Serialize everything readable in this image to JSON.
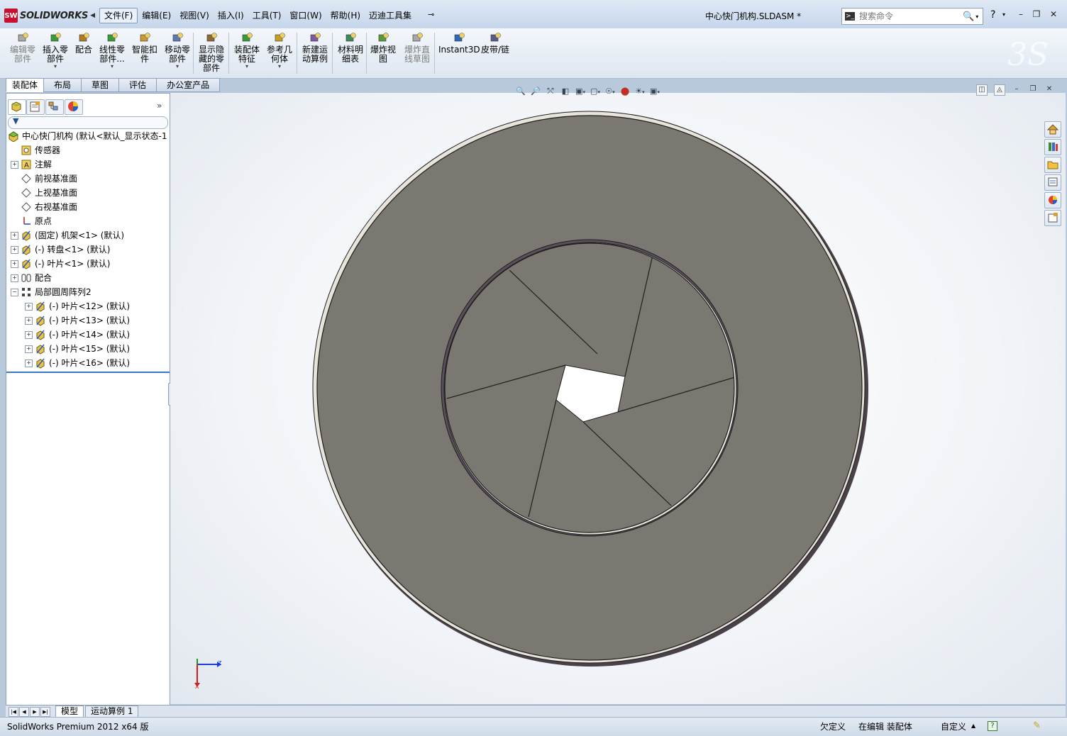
{
  "window": {
    "app_name": "SOLIDWORKS",
    "document_title": "中心快门机构.SLDASM *",
    "search_placeholder": "搜索命令",
    "help_label": "?"
  },
  "menu": [
    "文件(F)",
    "编辑(E)",
    "视图(V)",
    "插入(I)",
    "工具(T)",
    "窗口(W)",
    "帮助(H)",
    "迈迪工具集"
  ],
  "ribbon": {
    "buttons": [
      {
        "id": "edit-component",
        "label": "编辑零\n部件",
        "disabled": true,
        "icon": "edit-component-icon"
      },
      {
        "id": "insert-component",
        "label": "插入零\n部件",
        "dropdown": true,
        "icon": "insert-component-icon"
      },
      {
        "id": "mate",
        "label": "配合",
        "icon": "mate-icon"
      },
      {
        "id": "linear-pattern",
        "label": "线性零\n部件...",
        "dropdown": true,
        "icon": "linear-pattern-icon"
      },
      {
        "id": "smart-fastener",
        "label": "智能扣\n件",
        "icon": "smart-fastener-icon"
      },
      {
        "id": "move-component",
        "label": "移动零\n部件",
        "dropdown": true,
        "icon": "move-component-icon"
      },
      {
        "id": "show-hidden",
        "label": "显示隐\n藏的零\n部件",
        "icon": "show-hidden-icon"
      },
      {
        "id": "assembly-features",
        "label": "装配体\n特征",
        "dropdown": true,
        "icon": "assembly-features-icon"
      },
      {
        "id": "reference-geometry",
        "label": "参考几\n何体",
        "dropdown": true,
        "icon": "reference-geometry-icon"
      },
      {
        "id": "new-motion-study",
        "label": "新建运\n动算例",
        "icon": "motion-study-icon"
      },
      {
        "id": "bom",
        "label": "材料明\n细表",
        "icon": "bom-icon"
      },
      {
        "id": "exploded-view",
        "label": "爆炸视\n图",
        "icon": "exploded-view-icon"
      },
      {
        "id": "explode-line",
        "label": "爆炸直\n线草图",
        "disabled": true,
        "icon": "explode-line-icon"
      },
      {
        "id": "instant3d",
        "label": "Instant3D",
        "icon": "instant3d-icon"
      },
      {
        "id": "belt-chain",
        "label": "皮带/链",
        "icon": "belt-chain-icon"
      }
    ]
  },
  "cm_tabs": [
    "装配体",
    "布局",
    "草图",
    "评估",
    "办公室产品"
  ],
  "tree": {
    "root": "中心快门机构  (默认<默认_显示状态-1",
    "items": [
      {
        "label": "传感器",
        "indent": 1,
        "expand": false,
        "icon": "sensor-icon"
      },
      {
        "label": "注解",
        "indent": 1,
        "expand": true,
        "icon": "annotation-icon"
      },
      {
        "label": "前视基准面",
        "indent": 1,
        "expand": false,
        "icon": "plane-icon"
      },
      {
        "label": "上视基准面",
        "indent": 1,
        "expand": false,
        "icon": "plane-icon"
      },
      {
        "label": "右视基准面",
        "indent": 1,
        "expand": false,
        "icon": "plane-icon"
      },
      {
        "label": "原点",
        "indent": 1,
        "expand": false,
        "icon": "origin-icon"
      },
      {
        "label": "(固定) 机架<1> (默认)",
        "indent": 1,
        "expand": true,
        "icon": "part-icon"
      },
      {
        "label": "(-) 转盘<1> (默认)",
        "indent": 1,
        "expand": true,
        "icon": "part-icon"
      },
      {
        "label": "(-) 叶片<1> (默认)",
        "indent": 1,
        "expand": true,
        "icon": "part-icon"
      },
      {
        "label": "配合",
        "indent": 1,
        "expand": true,
        "icon": "mates-folder-icon"
      },
      {
        "label": "局部圆周阵列2",
        "indent": 1,
        "expand": true,
        "collapsed": true,
        "icon": "circular-pattern-icon"
      },
      {
        "label": "(-) 叶片<12> (默认)",
        "indent": 2,
        "expand": true,
        "icon": "part-icon"
      },
      {
        "label": "(-) 叶片<13> (默认)",
        "indent": 2,
        "expand": true,
        "icon": "part-icon"
      },
      {
        "label": "(-) 叶片<14> (默认)",
        "indent": 2,
        "expand": true,
        "icon": "part-icon"
      },
      {
        "label": "(-) 叶片<15> (默认)",
        "indent": 2,
        "expand": true,
        "icon": "part-icon"
      },
      {
        "label": "(-) 叶片<16> (默认)",
        "indent": 2,
        "expand": true,
        "icon": "part-icon"
      }
    ]
  },
  "triad": {
    "axis_z": "Z",
    "axis_x": "X"
  },
  "bottom_tabs": [
    "模型",
    "运动算例 1"
  ],
  "status": {
    "app_version": "SolidWorks Premium 2012 x64 版",
    "definition": "欠定义",
    "editing": "在编辑 装配体",
    "units": "自定义",
    "units_arrow": "▲"
  },
  "colors": {
    "model_face": "#7a7870",
    "model_edge": "#1e1e1e",
    "accent": "#3c78c8",
    "titlebar": "#c6d6ea"
  }
}
